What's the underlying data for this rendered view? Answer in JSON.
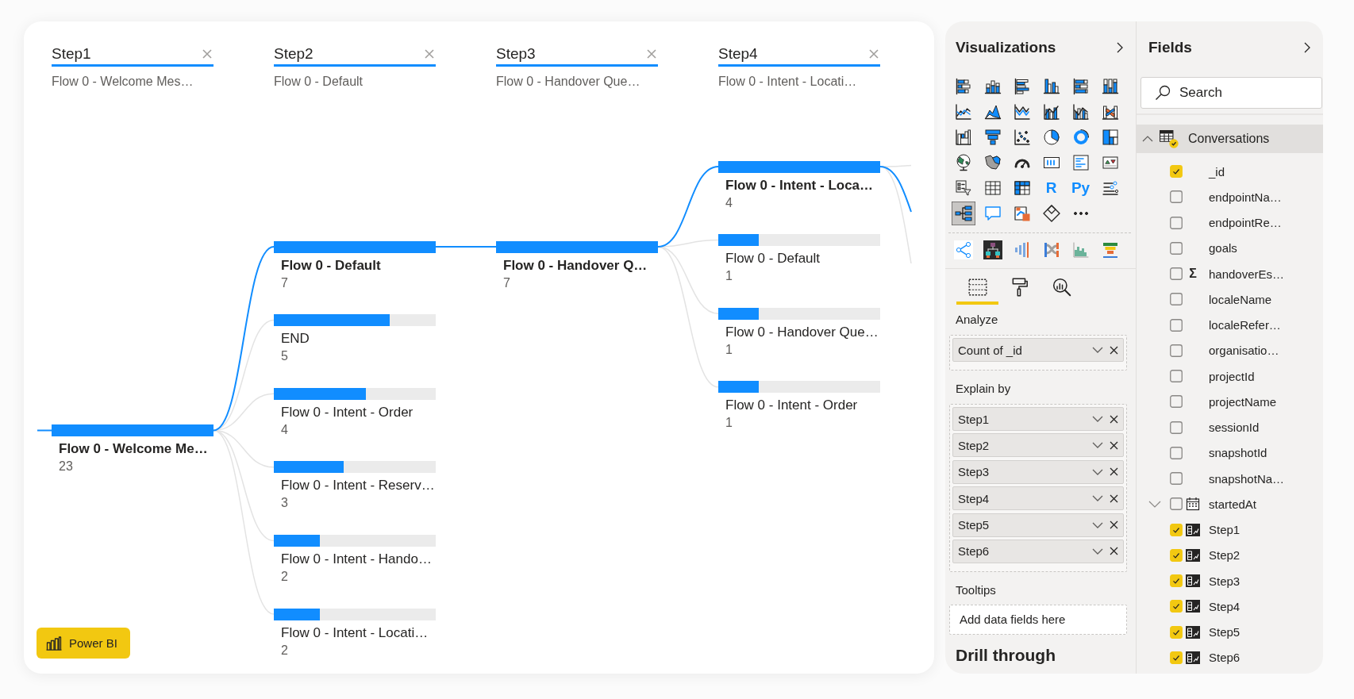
{
  "decomposition_tree": {
    "levels": [
      {
        "field": "Step1",
        "selection": "Flow 0 - Welcome Mes…",
        "nodes": [
          {
            "label": "Flow 0 - Welcome Me…",
            "value": "23",
            "level": 1,
            "selected": true
          }
        ]
      },
      {
        "field": "Step2",
        "selection": "Flow 0 - Default",
        "nodes": [
          {
            "label": "Flow 0 - Default",
            "value": "7",
            "level": 1,
            "selected": true
          },
          {
            "label": "END",
            "value": "5",
            "level": 0.714,
            "selected": false
          },
          {
            "label": "Flow 0 - Intent - Order",
            "value": "4",
            "level": 0.571,
            "selected": false
          },
          {
            "label": "Flow 0 - Intent - Reserv…",
            "value": "3",
            "level": 0.429,
            "selected": false
          },
          {
            "label": "Flow 0 - Intent - Hando…",
            "value": "2",
            "level": 0.286,
            "selected": false
          },
          {
            "label": "Flow 0 - Intent - Locati…",
            "value": "2",
            "level": 0.286,
            "selected": false
          }
        ]
      },
      {
        "field": "Step3",
        "selection": "Flow 0 - Handover Que…",
        "nodes": [
          {
            "label": "Flow 0 - Handover Q…",
            "value": "7",
            "level": 1,
            "selected": true
          }
        ]
      },
      {
        "field": "Step4",
        "selection": "Flow 0 - Intent - Locati…",
        "nodes": [
          {
            "label": "Flow 0 - Intent - Loca…",
            "value": "4",
            "level": 1,
            "selected": true
          },
          {
            "label": "Flow 0 - Default",
            "value": "1",
            "level": 0.25,
            "selected": false
          },
          {
            "label": "Flow 0 - Handover Que…",
            "value": "1",
            "level": 0.25,
            "selected": false
          },
          {
            "label": "Flow 0 - Intent - Order",
            "value": "1",
            "level": 0.25,
            "selected": false
          }
        ]
      }
    ],
    "badge": "Power BI"
  },
  "visualizations": {
    "title": "Visualizations",
    "gallery": [
      {
        "kind": "icon",
        "selected": false
      },
      {
        "kind": "icon",
        "selected": false
      },
      {
        "kind": "icon",
        "selected": false
      },
      {
        "kind": "icon",
        "selected": false
      },
      {
        "kind": "icon",
        "selected": false
      },
      {
        "kind": "icon",
        "selected": false
      },
      {
        "kind": "icon",
        "selected": false
      },
      {
        "kind": "icon",
        "selected": false
      },
      {
        "kind": "icon",
        "selected": false
      },
      {
        "kind": "icon",
        "selected": false
      },
      {
        "kind": "icon",
        "selected": false
      },
      {
        "kind": "icon",
        "selected": false
      },
      {
        "kind": "icon",
        "selected": false
      },
      {
        "kind": "icon",
        "selected": false
      },
      {
        "kind": "icon",
        "selected": false
      },
      {
        "kind": "icon",
        "selected": false
      },
      {
        "kind": "icon",
        "selected": false
      },
      {
        "kind": "icon",
        "selected": false
      },
      {
        "kind": "icon",
        "selected": false
      },
      {
        "kind": "icon",
        "selected": false
      },
      {
        "kind": "icon",
        "selected": false
      },
      {
        "kind": "icon",
        "selected": false
      },
      {
        "kind": "icon",
        "selected": false
      },
      {
        "kind": "icon",
        "selected": false
      },
      {
        "kind": "icon",
        "selected": false
      },
      {
        "kind": "icon",
        "selected": false
      },
      {
        "kind": "icon",
        "selected": false
      },
      {
        "kind": "text",
        "label": "R",
        "selected": false
      },
      {
        "kind": "text",
        "label": "Py",
        "selected": false
      },
      {
        "kind": "icon",
        "selected": false
      },
      {
        "kind": "icon",
        "selected": true
      },
      {
        "kind": "icon",
        "selected": false
      },
      {
        "kind": "icon",
        "selected": false
      },
      {
        "kind": "icon",
        "selected": false
      },
      {
        "kind": "icon",
        "selected": false
      }
    ],
    "tabs": [
      {
        "selected": true
      },
      {
        "selected": false
      },
      {
        "selected": false
      }
    ],
    "wells": [
      {
        "label": "Analyze",
        "items": [
          {
            "name": "Count of _id"
          }
        ]
      },
      {
        "label": "Explain by",
        "items": [
          {
            "name": "Step1"
          },
          {
            "name": "Step2"
          },
          {
            "name": "Step3"
          },
          {
            "name": "Step4"
          },
          {
            "name": "Step5"
          },
          {
            "name": "Step6"
          }
        ]
      },
      {
        "label": "Tooltips",
        "placeholder": "Add data fields here"
      }
    ],
    "next_section": "Drill through"
  },
  "fields_pane": {
    "title": "Fields",
    "search": {
      "placeholder": "Search"
    },
    "tables": [
      {
        "name": "Conversations",
        "expanded": true,
        "in_use": true,
        "fields": [
          {
            "name": "_id",
            "checked": true,
            "kind": "plain"
          },
          {
            "name": "endpointNa…",
            "checked": false,
            "kind": "plain"
          },
          {
            "name": "endpointRe…",
            "checked": false,
            "kind": "plain"
          },
          {
            "name": "goals",
            "checked": false,
            "kind": "plain"
          },
          {
            "name": "handoverEs…",
            "checked": false,
            "kind": "sum",
            "symbol": "Σ"
          },
          {
            "name": "localeName",
            "checked": false,
            "kind": "plain"
          },
          {
            "name": "localeRefer…",
            "checked": false,
            "kind": "plain"
          },
          {
            "name": "organisatio…",
            "checked": false,
            "kind": "plain"
          },
          {
            "name": "projectId",
            "checked": false,
            "kind": "plain"
          },
          {
            "name": "projectName",
            "checked": false,
            "kind": "plain"
          },
          {
            "name": "sessionId",
            "checked": false,
            "kind": "plain"
          },
          {
            "name": "snapshotId",
            "checked": false,
            "kind": "plain"
          },
          {
            "name": "snapshotNa…",
            "checked": false,
            "kind": "plain"
          },
          {
            "name": "startedAt",
            "checked": false,
            "kind": "date",
            "expanded": false
          },
          {
            "name": "Step1",
            "checked": true,
            "kind": "calculated"
          },
          {
            "name": "Step2",
            "checked": true,
            "kind": "calculated"
          },
          {
            "name": "Step3",
            "checked": true,
            "kind": "calculated"
          },
          {
            "name": "Step4",
            "checked": true,
            "kind": "calculated"
          },
          {
            "name": "Step5",
            "checked": true,
            "kind": "calculated"
          },
          {
            "name": "Step6",
            "checked": true,
            "kind": "calculated"
          }
        ]
      }
    ]
  }
}
